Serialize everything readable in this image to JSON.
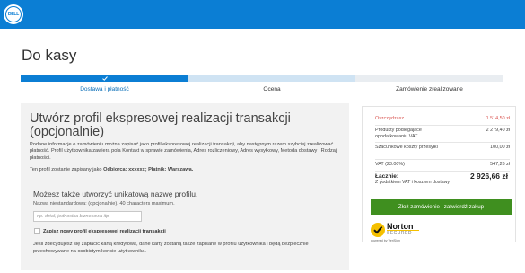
{
  "header": {
    "logo_text": "DELL",
    "bg_color": "#0b7ed4"
  },
  "page_title": "Do kasy",
  "steps": {
    "items": [
      {
        "label": "Dostawa i płatność",
        "state": "completed"
      },
      {
        "label": "Ocena",
        "state": "current"
      },
      {
        "label": "Zamówienie zrealizowane",
        "state": "upcoming"
      }
    ],
    "check_icon": "check-icon"
  },
  "profile": {
    "title": "Utwórz profil ekspresowej realizacji transakcji (opcjonalnie)",
    "para1": "Podane informacje o zamówieniu można zapisać jako profil ekspresowej realizacji transakcji, aby następnym razem szybciej zrealizować płatność. Profil użytkownika zawiera pola Kontakt w sprawie zamówienia, Adres rozliczeniowy, Adres wysyłkowy, Metoda dostawy i Rodzaj płatności.",
    "para2_prefix": "Ten profil zostanie zapisany jako ",
    "para2_bold": "Odbiorca: xxxxxx; Płatnik: Warszawa.",
    "subtitle": "Możesz także utworzyć unikatową nazwę profilu.",
    "field_label": "Nazwa niestandardowa: (opcjonalnie). 40 characters maximum.",
    "input_value": "",
    "input_placeholder": "np. dział, jednostka biznesowa itp.",
    "checkbox_label": "Zapisz nowy profil ekspresowej realizacji transakcji",
    "checkbox_checked": false,
    "bottom_para": "Jeśli zdecydujesz się zapłacić kartą kredytową, dane karty zostaną także zapisane w profilu użytkownika i będą bezpiecznie przechowywane na osobistym koncie użytkownika."
  },
  "summary": {
    "rows": [
      {
        "label": "Oszczędzasz",
        "value": "1 514,50 zł",
        "highlight": true
      },
      {
        "label": "Produkty podlegające opodatkowaniu VAT",
        "value": "2 279,40 zł",
        "highlight": false
      },
      {
        "label": "Szacunkowe koszty przesyłki",
        "value": "100,00 zł",
        "highlight": false
      },
      {
        "label": "VAT (23.00%)",
        "value": "547,26 zł",
        "highlight": false
      }
    ],
    "total_label": "Łącznie:",
    "total_sub": "Z podatkiem VAT i kosztem dostawy",
    "total_value": "2 926,66 zł",
    "accent_color": "#d9534f"
  },
  "order_button": {
    "label": "Złoż zamówienie i zatwierdź zakup",
    "color": "#3f8f1f"
  },
  "norton": {
    "name": "Norton",
    "secured": "SECURED",
    "powered_by": "powered by VeriSign",
    "icon": "norton-check-icon"
  }
}
